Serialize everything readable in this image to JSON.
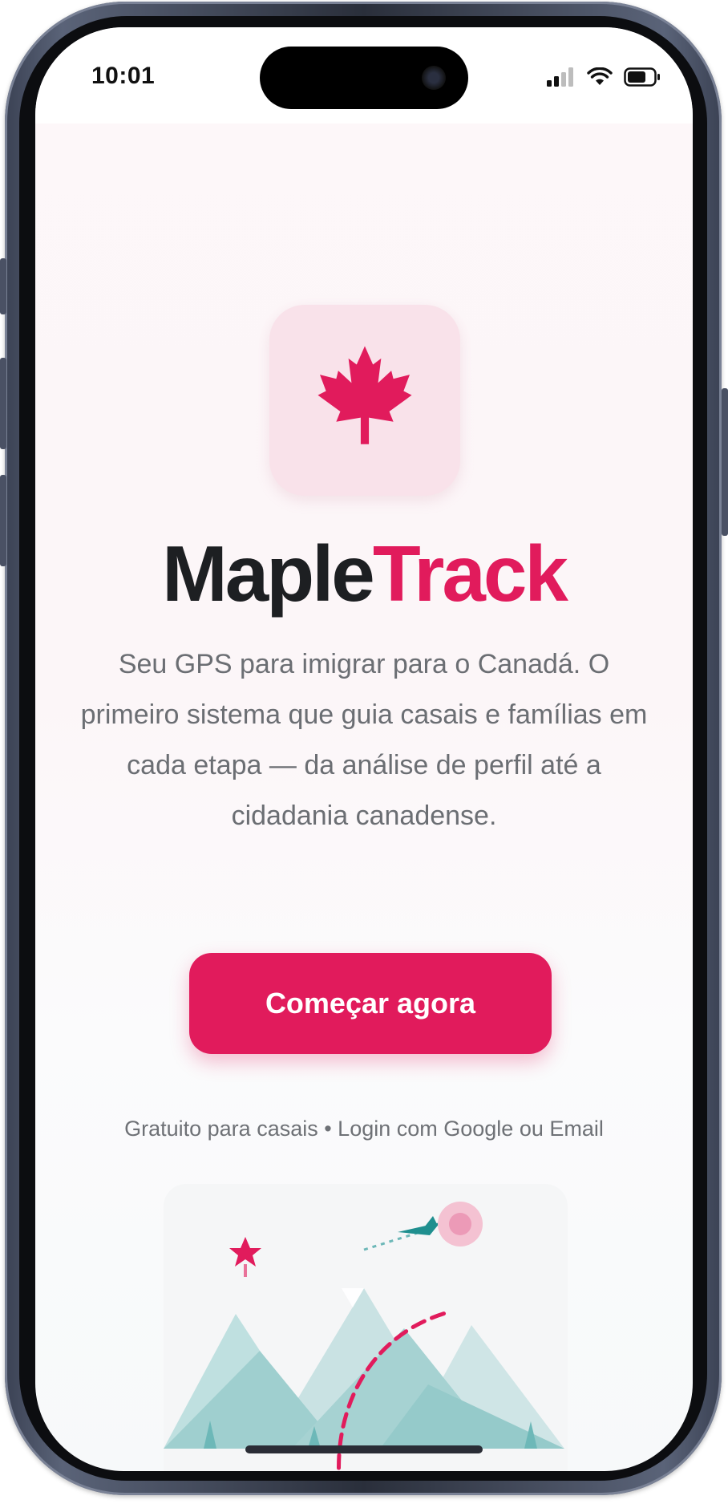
{
  "status_bar": {
    "time": "10:01"
  },
  "brand": {
    "part1": "Maple",
    "part2": "Track"
  },
  "hero": {
    "tagline": "Seu GPS para imigrar para o Canadá. O primeiro sistema que guia casais e famílias em cada etapa — da análise de perfil até a cidadania canadense."
  },
  "cta": {
    "label": "Começar agora"
  },
  "subnote": {
    "text": "Gratuito para casais • Login com Google ou Email"
  },
  "colors": {
    "accent": "#e11b5c",
    "text_dark": "#1d1f22",
    "text_muted": "#6b6e73",
    "icon_bg": "#f9e2ea",
    "mountain": "#9fcfcf"
  },
  "icons": {
    "app_icon": "maple-leaf-icon",
    "signal": "cellular-signal-icon",
    "wifi": "wifi-icon",
    "battery": "battery-icon"
  }
}
